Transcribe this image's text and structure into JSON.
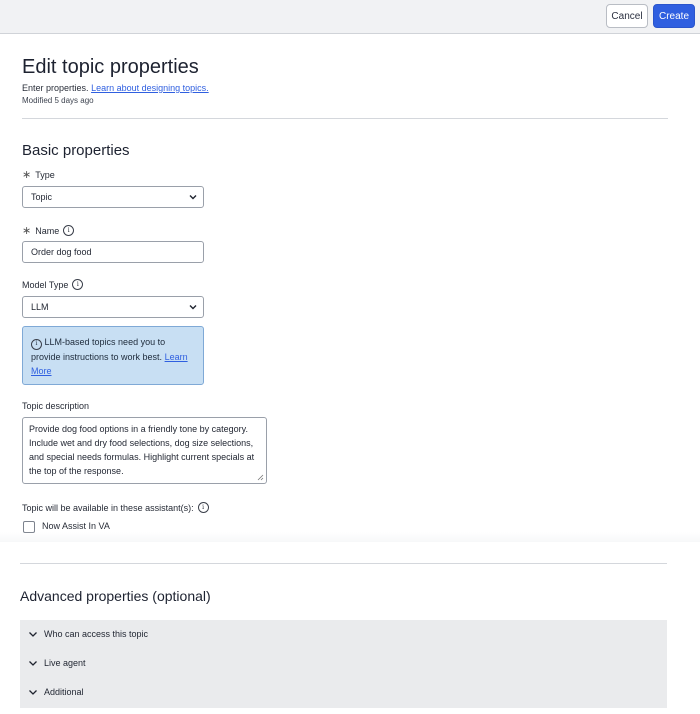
{
  "header": {
    "cancel_label": "Cancel",
    "create_label": "Create"
  },
  "page": {
    "title": "Edit topic properties",
    "intro_text": "Enter properties.",
    "intro_link": "Learn about designing topics.",
    "modified": "Modified 5 days ago"
  },
  "basic": {
    "title": "Basic properties",
    "type": {
      "label": "Type",
      "value": "Topic"
    },
    "name": {
      "label": "Name",
      "value": "Order dog food"
    },
    "model_type": {
      "label": "Model Type",
      "value": "LLM"
    },
    "callout": {
      "text": "LLM-based topics need you to provide instructions to work best.",
      "link": "Learn More"
    },
    "description": {
      "label": "Topic description",
      "value": "Provide dog food options in a friendly tone by category. Include wet and dry food selections, dog size selections, and special needs formulas. Highlight current specials at the top of the response."
    },
    "assistants": {
      "label": "Topic will be available in these assistant(s):",
      "option": "Now Assist In VA"
    }
  },
  "advanced": {
    "title": "Advanced properties (optional)",
    "items": [
      {
        "label": "Who can access this topic"
      },
      {
        "label": "Live agent"
      },
      {
        "label": "Additional"
      }
    ]
  },
  "icons": {
    "chevron": "chevron-down-icon",
    "info": "info-icon",
    "required": "asterisk-icon"
  }
}
